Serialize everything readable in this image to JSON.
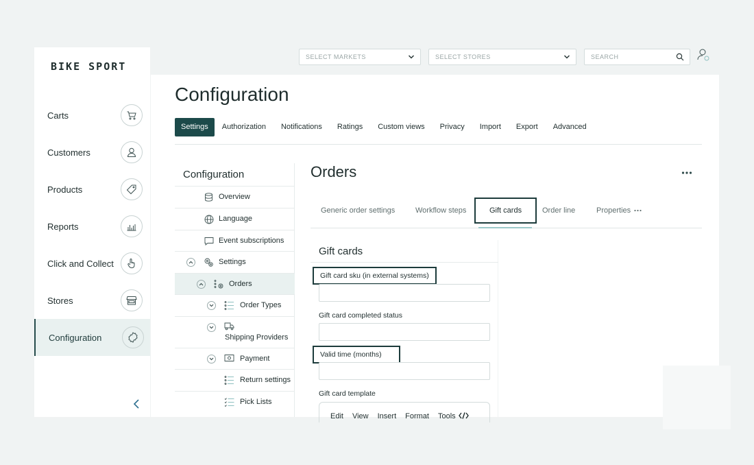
{
  "brand": "BIKE SPORT",
  "topbar": {
    "markets_label": "SELECT MARKETS",
    "stores_label": "SELECT STORES",
    "search_placeholder": "SEARCH"
  },
  "sidebar": {
    "items": [
      {
        "label": "Carts",
        "icon": "cart-icon"
      },
      {
        "label": "Customers",
        "icon": "user-icon"
      },
      {
        "label": "Products",
        "icon": "tag-icon"
      },
      {
        "label": "Reports",
        "icon": "chart-icon"
      },
      {
        "label": "Click and Collect",
        "icon": "hand-pointer-icon"
      },
      {
        "label": "Stores",
        "icon": "storefront-icon"
      },
      {
        "label": "Configuration",
        "icon": "gear-icon",
        "active": true
      }
    ]
  },
  "page": {
    "title": "Configuration",
    "tabs": [
      "Settings",
      "Authorization",
      "Notifications",
      "Ratings",
      "Custom views",
      "Privacy",
      "Import",
      "Export",
      "Advanced"
    ],
    "active_tab": "Settings"
  },
  "tree": {
    "title": "Configuration",
    "items": [
      {
        "label": "Overview"
      },
      {
        "label": "Language"
      },
      {
        "label": "Event subscriptions"
      },
      {
        "label": "Settings"
      },
      {
        "label": "Orders",
        "selected": true
      },
      {
        "label": "Order Types"
      },
      {
        "label": "Shipping Providers"
      },
      {
        "label": "Payment"
      },
      {
        "label": "Return settings"
      },
      {
        "label": "Pick Lists"
      }
    ]
  },
  "orders": {
    "title": "Orders",
    "subtabs": [
      "Generic order settings",
      "Workflow steps",
      "Gift cards",
      "Order line",
      "Properties"
    ],
    "active_subtab": "Gift cards"
  },
  "gift_cards": {
    "title": "Gift cards",
    "fields": [
      {
        "label": "Gift card sku (in external systems)",
        "value": ""
      },
      {
        "label": "Gift card completed status",
        "value": ""
      },
      {
        "label": "Valid time (months)",
        "value": ""
      }
    ],
    "template_label": "Gift card template",
    "editor_menu": [
      "Edit",
      "View",
      "Insert",
      "Format",
      "Tools"
    ]
  }
}
